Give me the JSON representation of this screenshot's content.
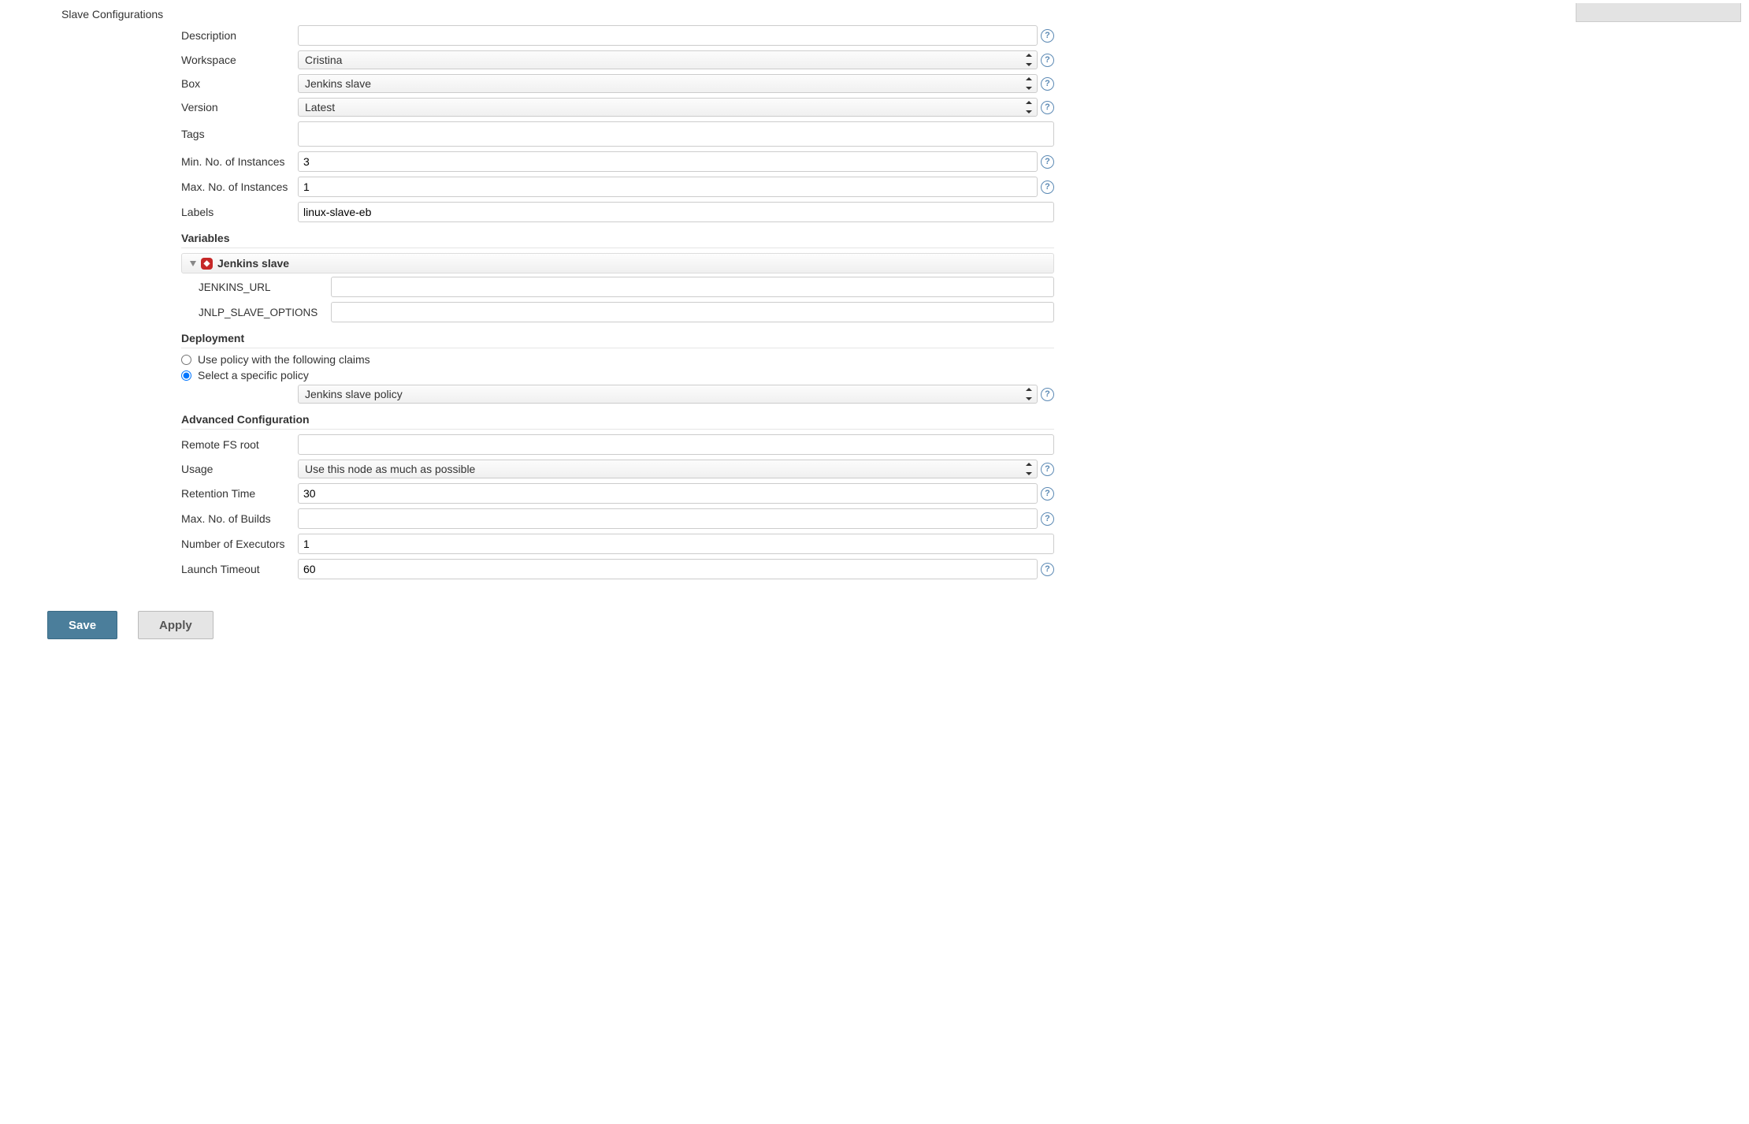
{
  "sectionTitle": "Slave Configurations",
  "fields": {
    "description": {
      "label": "Description",
      "value": ""
    },
    "workspace": {
      "label": "Workspace",
      "value": "Cristina"
    },
    "box": {
      "label": "Box",
      "value": "Jenkins slave"
    },
    "version": {
      "label": "Version",
      "value": "Latest"
    },
    "tags": {
      "label": "Tags",
      "value": ""
    },
    "minInstances": {
      "label": "Min. No. of Instances",
      "value": "3"
    },
    "maxInstances": {
      "label": "Max. No. of Instances",
      "value": "1"
    },
    "labels": {
      "label": "Labels",
      "value": "linux-slave-eb"
    }
  },
  "variables": {
    "header": "Variables",
    "groupName": "Jenkins slave",
    "items": [
      {
        "label": "JENKINS_URL",
        "value": ""
      },
      {
        "label": "JNLP_SLAVE_OPTIONS",
        "value": ""
      }
    ]
  },
  "deployment": {
    "header": "Deployment",
    "option1": "Use policy with the following claims",
    "option2": "Select a specific policy",
    "selectedIndex": 1,
    "policy": "Jenkins slave policy"
  },
  "advanced": {
    "header": "Advanced Configuration",
    "remoteFs": {
      "label": "Remote FS root",
      "value": ""
    },
    "usage": {
      "label": "Usage",
      "value": "Use this node as much as possible"
    },
    "retention": {
      "label": "Retention Time",
      "value": "30"
    },
    "maxBuilds": {
      "label": "Max. No. of Builds",
      "value": ""
    },
    "executors": {
      "label": "Number of Executors",
      "value": "1"
    },
    "launchTimeout": {
      "label": "Launch Timeout",
      "value": "60"
    }
  },
  "buttons": {
    "save": "Save",
    "apply": "Apply"
  }
}
